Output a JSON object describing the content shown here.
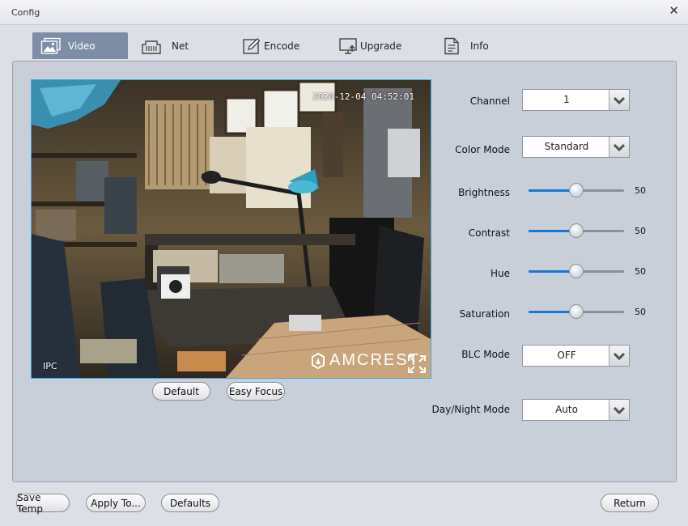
{
  "window": {
    "title": "Config",
    "close_glyph": "✕"
  },
  "tabs": [
    {
      "label": "Video",
      "icon": "video-icon",
      "active": true
    },
    {
      "label": "Net",
      "icon": "network-icon",
      "active": false
    },
    {
      "label": "Encode",
      "icon": "encode-icon",
      "active": false
    },
    {
      "label": "Upgrade",
      "icon": "upgrade-icon",
      "active": false
    },
    {
      "label": "Info",
      "icon": "info-icon",
      "active": false
    }
  ],
  "video": {
    "timestamp": "2020-12-04 04:52:01",
    "channel_name": "IPC",
    "watermark": "AMCREST",
    "fullscreen_icon": "fullscreen-icon"
  },
  "video_buttons": {
    "default_label": "Default",
    "easy_focus_label": "Easy Focus"
  },
  "settings": {
    "channel": {
      "label": "Channel",
      "value": "1"
    },
    "color_mode": {
      "label": "Color Mode",
      "value": "Standard"
    },
    "brightness": {
      "label": "Brightness",
      "value": "50",
      "level": 50
    },
    "contrast": {
      "label": "Contrast",
      "value": "50",
      "level": 50
    },
    "hue": {
      "label": "Hue",
      "value": "50",
      "level": 50
    },
    "saturation": {
      "label": "Saturation",
      "value": "50",
      "level": 50
    },
    "blc_mode": {
      "label": "BLC Mode",
      "value": "OFF"
    },
    "day_night_mode": {
      "label": "Day/Night Mode",
      "value": "Auto"
    }
  },
  "footer": {
    "save_temp": "Save Temp",
    "apply_to": "Apply To...",
    "defaults": "Defaults",
    "return": "Return"
  },
  "colors": {
    "accent": "#1976d2",
    "tab_active": "#7d8da6",
    "video_border": "#3da7e8",
    "panel": "#c9cfd9"
  }
}
